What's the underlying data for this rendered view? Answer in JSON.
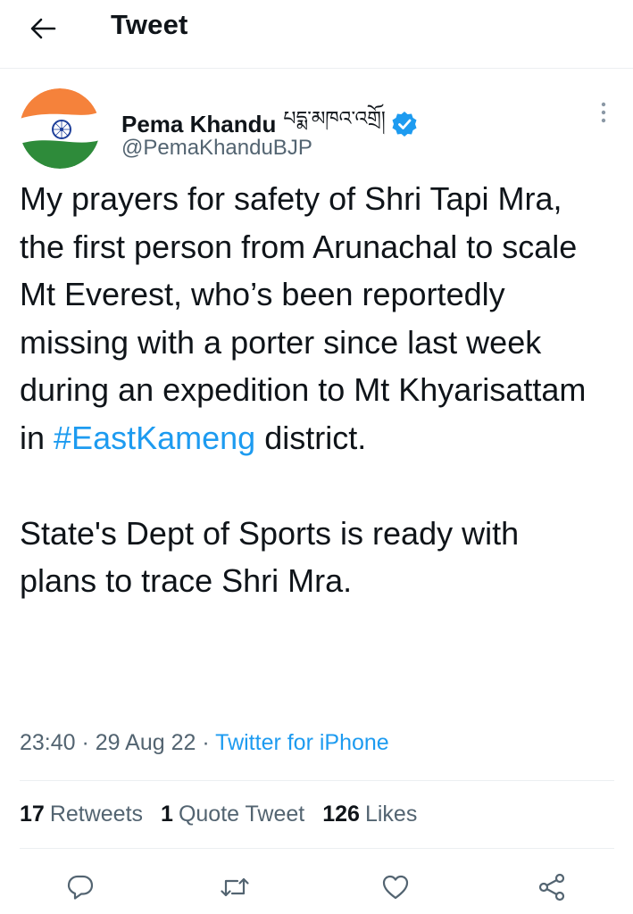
{
  "header": {
    "title": "Tweet",
    "back_icon": "arrow-left-icon"
  },
  "author": {
    "name": "Pema Khandu",
    "name_tibetan": "པདྨ་མཁའ་འགྲོ།",
    "handle": "@PemaKhanduBJP",
    "verified": true,
    "avatar": "india-flag-avatar"
  },
  "tweet": {
    "line_part1": "My prayers for safety of Shri Tapi Mra, the first person from Arunachal to scale Mt Everest, who’s been reportedly missing with a porter since last week during an expedition to Mt Khyarisattam in ",
    "hashtag": "#EastKameng",
    "line_part2": " district.",
    "paragraph2": "State's Dept of Sports is ready with plans to trace Shri Mra."
  },
  "meta": {
    "time": "23:40",
    "separator": " · ",
    "date": "29 Aug 22",
    "source": "Twitter for iPhone"
  },
  "stats": {
    "retweets_count": "17",
    "retweets_label": "Retweets",
    "quotes_count": "1",
    "quotes_label": "Quote Tweet",
    "likes_count": "126",
    "likes_label": "Likes"
  },
  "actions": [
    "reply-icon",
    "retweet-icon",
    "like-icon",
    "share-icon"
  ],
  "colors": {
    "accent": "#1d9bf0",
    "secondary_text": "#536471",
    "primary_text": "#0f1419",
    "divider": "#eceff1"
  }
}
